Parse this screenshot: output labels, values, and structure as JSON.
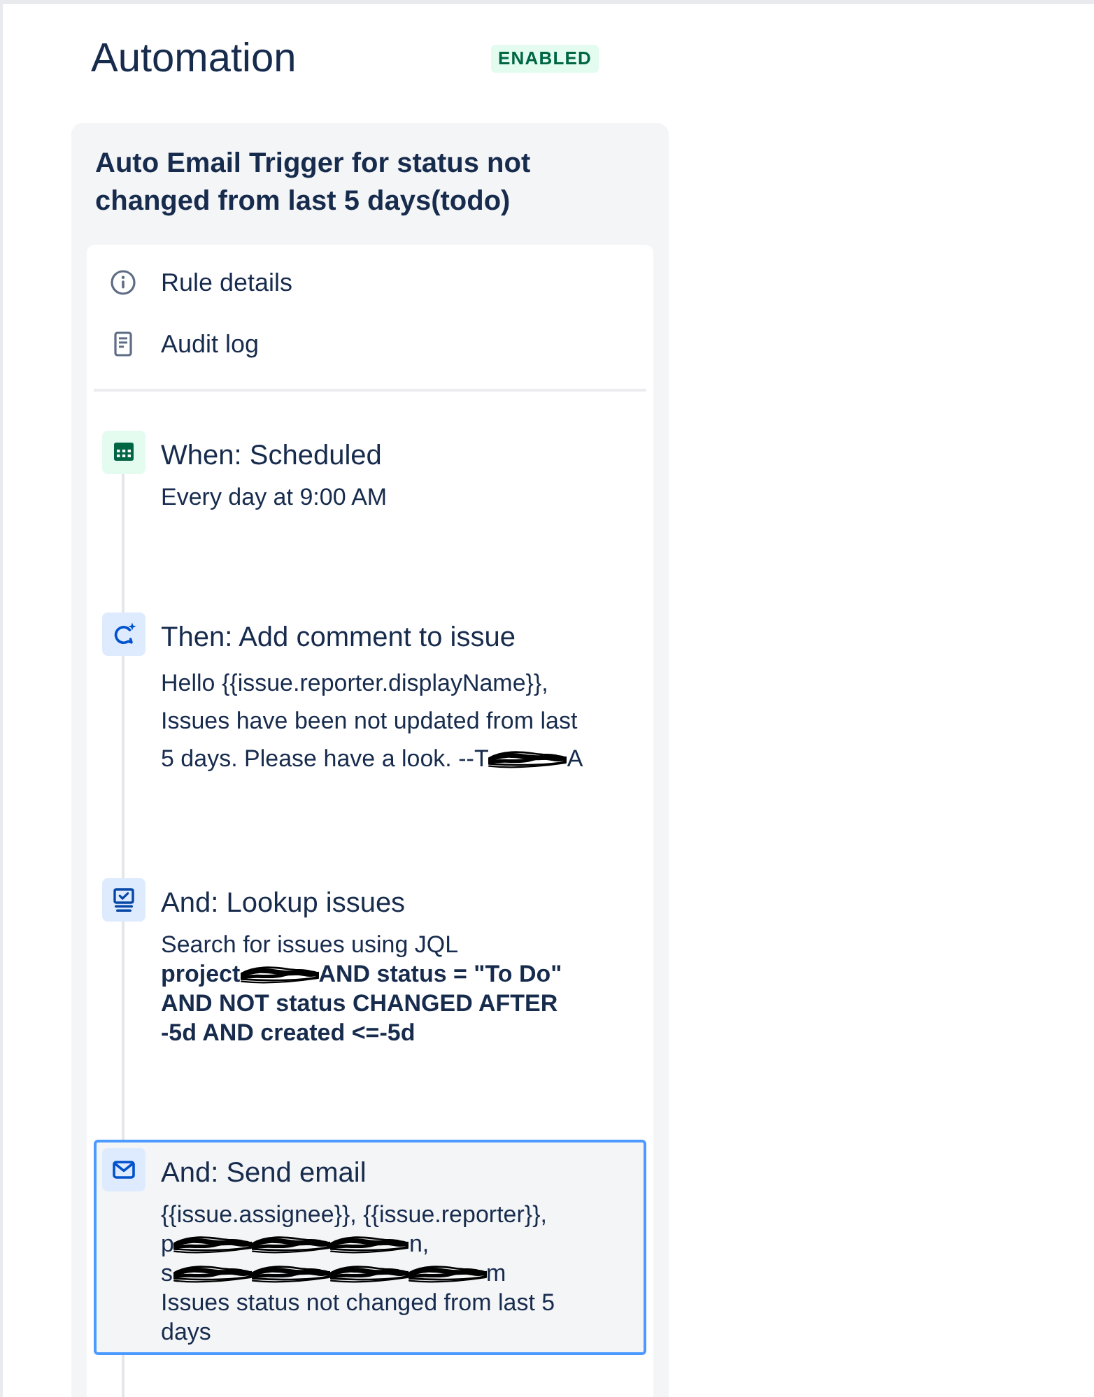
{
  "header": {
    "title": "Automation",
    "badge": "ENABLED"
  },
  "rule": {
    "name": "Auto Email Trigger for status not changed from last 5 days(todo)",
    "links": [
      {
        "kind": "details",
        "label": "Rule details"
      },
      {
        "kind": "log",
        "label": "Audit log"
      }
    ],
    "steps": [
      {
        "kind": "schedule",
        "title": "When: Scheduled",
        "selected": false,
        "lines": [
          {
            "bold": false,
            "parts": [
              {
                "kind": "text",
                "text": "Every day at 9:00 AM"
              }
            ]
          }
        ]
      },
      {
        "kind": "comment",
        "title": "Then: Add comment to issue",
        "selected": false,
        "lines": [
          {
            "bold": false,
            "parts": [
              {
                "kind": "text",
                "text": "Hello {{issue.reporter.displayName}},"
              }
            ]
          },
          {
            "bold": false,
            "parts": [
              {
                "kind": "text",
                "text": "Issues have been not updated from last"
              }
            ]
          },
          {
            "bold": false,
            "parts": [
              {
                "kind": "text",
                "text": "5 days. Please have a look. --T"
              },
              {
                "kind": "redacted"
              },
              {
                "kind": "text",
                "text": "A"
              }
            ]
          }
        ]
      },
      {
        "kind": "lookup",
        "title": "And: Lookup issues",
        "selected": false,
        "lines": [
          {
            "bold": false,
            "parts": [
              {
                "kind": "text",
                "text": "Search for issues using JQL"
              }
            ]
          },
          {
            "bold": true,
            "parts": [
              {
                "kind": "text",
                "text": "project"
              },
              {
                "kind": "redacted"
              },
              {
                "kind": "text",
                "text": "AND status = \"To Do\""
              }
            ]
          },
          {
            "bold": true,
            "parts": [
              {
                "kind": "text",
                "text": "AND NOT status CHANGED AFTER"
              }
            ]
          },
          {
            "bold": true,
            "parts": [
              {
                "kind": "text",
                "text": "-5d AND created <=-5d"
              }
            ]
          }
        ]
      },
      {
        "kind": "email",
        "title": "And: Send email",
        "selected": true,
        "lines": [
          {
            "bold": false,
            "parts": [
              {
                "kind": "text",
                "text": "{{issue.assignee}}, {{issue.reporter}},"
              }
            ]
          },
          {
            "bold": false,
            "parts": [
              {
                "kind": "text",
                "text": "p"
              },
              {
                "kind": "redacted"
              },
              {
                "kind": "redacted"
              },
              {
                "kind": "redacted"
              },
              {
                "kind": "text",
                "text": "n,"
              }
            ]
          },
          {
            "bold": false,
            "parts": [
              {
                "kind": "text",
                "text": "s"
              },
              {
                "kind": "redacted"
              },
              {
                "kind": "redacted"
              },
              {
                "kind": "redacted"
              },
              {
                "kind": "redacted"
              },
              {
                "kind": "text",
                "text": "m"
              }
            ]
          },
          {
            "bold": false,
            "parts": [
              {
                "kind": "text",
                "text": "Issues status not changed from last 5"
              }
            ]
          },
          {
            "bold": false,
            "parts": [
              {
                "kind": "text",
                "text": "days"
              }
            ]
          }
        ]
      }
    ]
  }
}
